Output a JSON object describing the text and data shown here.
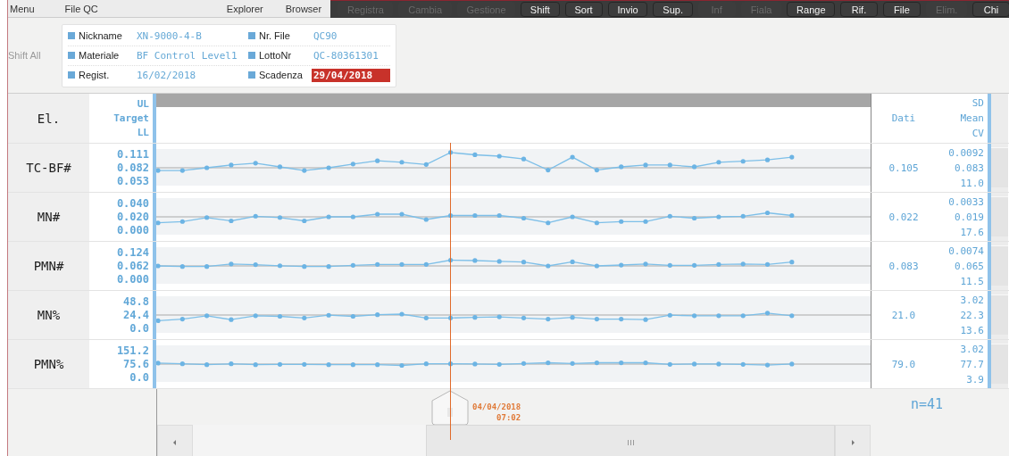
{
  "menu_left": [
    "Menu",
    "File QC"
  ],
  "menu_right": [
    "Explorer",
    "Browser"
  ],
  "toolbar": [
    {
      "label": "Registra",
      "disabled": true
    },
    {
      "label": "Cambia",
      "disabled": true
    },
    {
      "label": "Gestione",
      "disabled": true
    },
    {
      "label": "Shift",
      "disabled": false
    },
    {
      "label": "Sort",
      "disabled": false
    },
    {
      "label": "Invio",
      "disabled": false
    },
    {
      "label": "Sup.",
      "disabled": false
    },
    {
      "label": "Inf",
      "disabled": true
    },
    {
      "label": "Fiala",
      "disabled": true
    },
    {
      "label": "Range",
      "disabled": false
    },
    {
      "label": "Rif.",
      "disabled": false
    },
    {
      "label": "File",
      "disabled": false
    },
    {
      "label": "Elim.",
      "disabled": true
    },
    {
      "label": "Chi",
      "disabled": false
    }
  ],
  "shift_all": "Shift All",
  "info": [
    [
      {
        "label": "Nickname",
        "value": "XN-9000-4-B",
        "expired": false
      },
      {
        "label": "Nr. File",
        "value": "QC90",
        "expired": false
      }
    ],
    [
      {
        "label": "Materiale",
        "value": "BF Control Level1",
        "expired": false
      },
      {
        "label": "LottoNr",
        "value": "QC-80361301",
        "expired": false
      }
    ],
    [
      {
        "label": "Regist.",
        "value": "16/02/2018",
        "expired": false
      },
      {
        "label": "Scadenza",
        "value": "29/04/2018",
        "expired": true
      }
    ]
  ],
  "header": {
    "element": "El.",
    "limits": [
      "UL",
      "Target",
      "LL"
    ],
    "dati": "Dati",
    "stats": [
      "SD",
      "Mean",
      "CV"
    ]
  },
  "rows": [
    {
      "name": "TC-BF#",
      "dati": "0.105",
      "sd": "0.0092",
      "mean": "0.083",
      "cv": "11.0",
      "chart_data": {
        "type": "line",
        "ylim": [
          0.03,
          0.134
        ],
        "yticks": [
          {
            "value": 0.111,
            "label": "0.111"
          },
          {
            "value": 0.082,
            "label": "0.082"
          },
          {
            "value": 0.053,
            "label": "0.053"
          }
        ],
        "values": [
          0.076,
          0.076,
          0.082,
          0.088,
          0.092,
          0.084,
          0.076,
          0.082,
          0.09,
          0.097,
          0.094,
          0.089,
          0.115,
          0.11,
          0.107,
          0.101,
          0.077,
          0.105,
          0.077,
          0.084,
          0.088,
          0.088,
          0.084,
          0.094,
          0.096,
          0.099,
          0.105
        ]
      }
    },
    {
      "name": "MN#",
      "dati": "0.022",
      "sd": "0.0033",
      "mean": "0.019",
      "cv": "17.6",
      "chart_data": {
        "type": "line",
        "ylim": [
          -0.016,
          0.056
        ],
        "yticks": [
          {
            "value": 0.04,
            "label": "0.040"
          },
          {
            "value": 0.02,
            "label": "0.020"
          },
          {
            "value": 0.0,
            "label": "0.000"
          }
        ],
        "values": [
          0.011,
          0.013,
          0.019,
          0.014,
          0.021,
          0.019,
          0.014,
          0.02,
          0.02,
          0.024,
          0.024,
          0.016,
          0.022,
          0.022,
          0.022,
          0.018,
          0.011,
          0.02,
          0.011,
          0.013,
          0.013,
          0.021,
          0.018,
          0.02,
          0.021,
          0.026,
          0.022
        ]
      }
    },
    {
      "name": "PMN#",
      "dati": "0.083",
      "sd": "0.0074",
      "mean": "0.065",
      "cv": "11.5",
      "chart_data": {
        "type": "line",
        "ylim": [
          -0.05,
          0.174
        ],
        "yticks": [
          {
            "value": 0.124,
            "label": "0.124"
          },
          {
            "value": 0.062,
            "label": "0.062"
          },
          {
            "value": 0.0,
            "label": "0.000"
          }
        ],
        "values": [
          0.062,
          0.059,
          0.059,
          0.071,
          0.068,
          0.063,
          0.059,
          0.059,
          0.065,
          0.069,
          0.069,
          0.069,
          0.089,
          0.087,
          0.083,
          0.08,
          0.062,
          0.081,
          0.062,
          0.066,
          0.071,
          0.065,
          0.065,
          0.069,
          0.071,
          0.069,
          0.08
        ]
      }
    },
    {
      "name": "MN%",
      "dati": "21.0",
      "sd": "3.02",
      "mean": "22.3",
      "cv": "13.6",
      "chart_data": {
        "type": "line",
        "ylim": [
          -19.5,
          68.3
        ],
        "yticks": [
          {
            "value": 48.8,
            "label": "48.8"
          },
          {
            "value": 24.4,
            "label": "24.4"
          },
          {
            "value": 0.0,
            "label": "0.0"
          }
        ],
        "values": [
          14,
          17,
          23,
          16,
          23,
          22,
          19,
          24,
          22,
          25,
          26,
          19,
          19,
          20,
          21,
          19,
          17,
          20,
          17,
          17,
          16,
          24,
          23,
          23,
          23,
          28,
          23
        ]
      }
    },
    {
      "name": "PMN%",
      "dati": "79.0",
      "sd": "3.02",
      "mean": "77.7",
      "cv": "3.9",
      "chart_data": {
        "type": "line",
        "ylim": [
          -60.5,
          211.7
        ],
        "yticks": [
          {
            "value": 151.2,
            "label": "151.2"
          },
          {
            "value": 75.6,
            "label": "75.6"
          },
          {
            "value": 0.0,
            "label": "0.0"
          }
        ],
        "values": [
          81,
          77,
          72,
          77,
          72,
          74,
          74,
          72,
          72,
          72,
          68,
          77,
          77,
          76,
          74,
          79,
          83,
          79,
          83,
          83,
          83,
          74,
          76,
          76,
          74,
          70,
          76
        ]
      }
    }
  ],
  "cursor": {
    "date": "04/04/2018",
    "time": "07:02"
  },
  "count": "n=41"
}
